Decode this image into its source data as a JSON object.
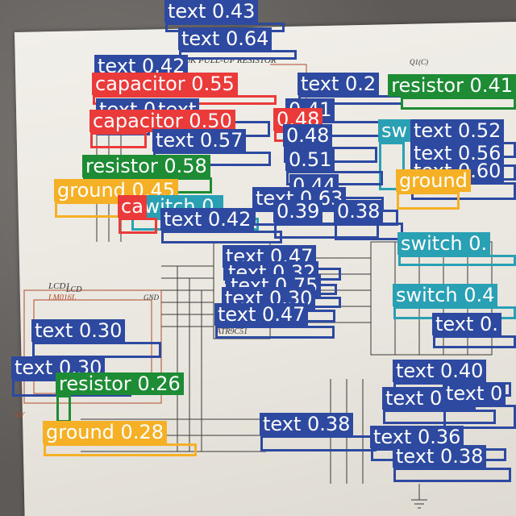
{
  "image": {
    "subject": "hand-drawn circuit schematic on paper with object-detection overlays"
  },
  "classes": {
    "text": {
      "color": "#2e4aa0"
    },
    "capacitor": {
      "color": "#ea3a3a"
    },
    "resistor": {
      "color": "#1e8c35"
    },
    "switch": {
      "color": "#2aa0b4"
    },
    "ground": {
      "color": "#f6b026"
    }
  },
  "paper_text": [
    {
      "text": "10K PULL-UP RESISTOR"
    },
    {
      "text": "LCD1"
    },
    {
      "text": "LM016L"
    },
    {
      "text": "LCD"
    },
    {
      "text": "ATR9C51"
    },
    {
      "text": "GND"
    },
    {
      "text": "5V"
    },
    {
      "text": "Q1(C)"
    }
  ],
  "detections": [
    {
      "class": "text",
      "label": "text 0.43"
    },
    {
      "class": "text",
      "label": "text 0.64"
    },
    {
      "class": "text",
      "label": "text 0.42"
    },
    {
      "class": "capacitor",
      "label": "capacitor 0.55"
    },
    {
      "class": "text",
      "label": "text 0.2"
    },
    {
      "class": "resistor",
      "label": "resistor 0.41"
    },
    {
      "class": "text",
      "label": "text 0.51"
    },
    {
      "class": "text",
      "label": "text"
    },
    {
      "class": "text",
      "label": "0.41"
    },
    {
      "class": "capacitor",
      "label": "capacitor 0.50"
    },
    {
      "class": "capacitor",
      "label": "0.48"
    },
    {
      "class": "text",
      "label": "text 0.57"
    },
    {
      "class": "text",
      "label": "0.48"
    },
    {
      "class": "switch",
      "label": "sw"
    },
    {
      "class": "text",
      "label": "text 0.52"
    },
    {
      "class": "text",
      "label": "0.51"
    },
    {
      "class": "text",
      "label": "text 0.56"
    },
    {
      "class": "resistor",
      "label": "resistor 0.58"
    },
    {
      "class": "text",
      "label": "text 0.60"
    },
    {
      "class": "text",
      "label": "0.44"
    },
    {
      "class": "ground",
      "label": "ground 0.45"
    },
    {
      "class": "ground",
      "label": "ground"
    },
    {
      "class": "switch",
      "label": "switch 0."
    },
    {
      "class": "text",
      "label": "text 0.63"
    },
    {
      "class": "capacitor",
      "label": "ca"
    },
    {
      "class": "text",
      "label": "text 0.42"
    },
    {
      "class": "text",
      "label": "0.39"
    },
    {
      "class": "text",
      "label": "0.38"
    },
    {
      "class": "switch",
      "label": "switch 0."
    },
    {
      "class": "text",
      "label": "text 0.47"
    },
    {
      "class": "text",
      "label": "text 0.32"
    },
    {
      "class": "text",
      "label": "text 0.75"
    },
    {
      "class": "switch",
      "label": "switch 0.4"
    },
    {
      "class": "text",
      "label": "text 0.30"
    },
    {
      "class": "text",
      "label": "text 0.47"
    },
    {
      "class": "text",
      "label": "text 0."
    },
    {
      "class": "text",
      "label": "text 0.30"
    },
    {
      "class": "text",
      "label": "text 0.30"
    },
    {
      "class": "resistor",
      "label": "resistor 0.26"
    },
    {
      "class": "text",
      "label": "text 0.40"
    },
    {
      "class": "text",
      "label": "text 0.37"
    },
    {
      "class": "text",
      "label": "text 0"
    },
    {
      "class": "ground",
      "label": "ground 0.28"
    },
    {
      "class": "text",
      "label": "text 0.38"
    },
    {
      "class": "text",
      "label": "text 0.36"
    },
    {
      "class": "text",
      "label": "text 0.38"
    }
  ]
}
